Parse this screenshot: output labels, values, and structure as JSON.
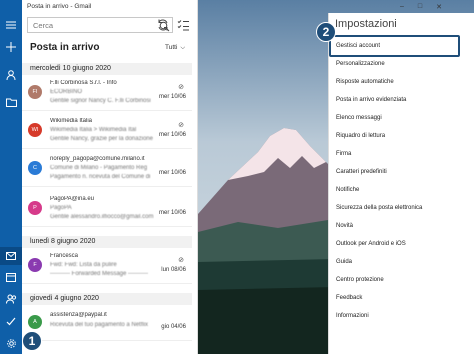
{
  "window": {
    "title": "Posta in arrivo - Gmail"
  },
  "search": {
    "placeholder": "Cerca"
  },
  "folder": {
    "title": "Posta in arrivo",
    "filter": "Tutti"
  },
  "groups": [
    {
      "date": "mercoledì 10 giugno 2020",
      "messages": [
        {
          "initials": "FI",
          "color": "#b07a6a",
          "from": "F.lli Corbinosa S.r.l. - Info",
          "subject": "ECORBINO",
          "preview": "Gentile signor Nancy C. F.lli Corbinosi",
          "date": "mer 10/06",
          "attachment": true
        },
        {
          "initials": "WI",
          "color": "#d63a2a",
          "from": "Wikimedia Italia",
          "subject": "Wikimedia Italia > Wikimedia Ital",
          "preview": "Gentile Nancy, grazie per la donazione",
          "date": "mer 10/06",
          "attachment": true
        },
        {
          "initials": "C",
          "color": "#2a7bd6",
          "from": "noreply_pagopa@comune.milano.it",
          "subject": "Comune di Milano - Pagamento Reg",
          "preview": "Pagamento n. ricevuta del Comune di",
          "date": "mer 10/06",
          "attachment": false
        },
        {
          "initials": "P",
          "color": "#d63a8a",
          "from": "PagoPA@ina.eu",
          "subject": "PagoPA",
          "preview": "Gentile alessandro.ilfiocco@gmail.com",
          "date": "mer 10/06",
          "attachment": false
        }
      ]
    },
    {
      "date": "lunedì 8 giugno 2020",
      "messages": [
        {
          "initials": "F",
          "color": "#8a3ab0",
          "from": "Francesca",
          "subject": "Fwd: Fwd: Lista da pulire",
          "preview": "---------- Forwarded Message ----------",
          "date": "lun 08/06",
          "attachment": true
        }
      ]
    },
    {
      "date": "giovedì 4 giugno 2020",
      "messages": [
        {
          "initials": "A",
          "color": "#3a9a4a",
          "from": "assistenza@paypal.it",
          "subject": "Ricevuta del tuo pagamento a Netflix",
          "preview": "",
          "date": "gio 04/06",
          "attachment": false
        }
      ]
    }
  ],
  "settings": {
    "title": "Impostazioni",
    "items": [
      "Gestisci account",
      "Personalizzazione",
      "Risposte automatiche",
      "Posta in arrivo evidenziata",
      "Elenco messaggi",
      "Riquadro di lettura",
      "Firma",
      "Caratteri predefiniti",
      "Notifiche",
      "Sicurezza della posta elettronica",
      "Novità",
      "Outlook per Android e iOS",
      "Guida",
      "Centro protezione",
      "Feedback",
      "Informazioni"
    ]
  },
  "callouts": [
    "1",
    "2"
  ],
  "colors": {
    "rail": "#0f5fa8",
    "callout": "#1f4e79"
  }
}
